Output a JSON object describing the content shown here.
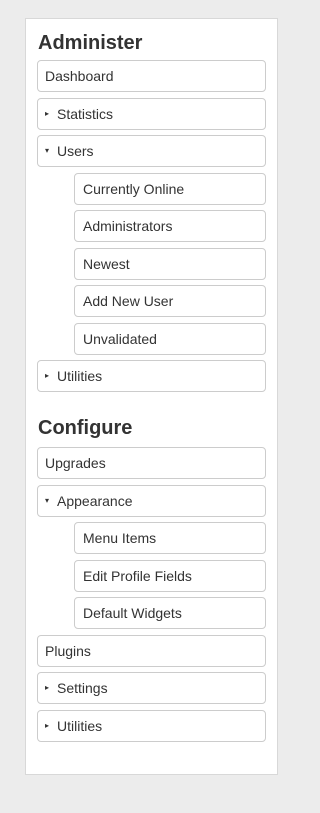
{
  "sections": [
    {
      "title": "Administer",
      "items": [
        {
          "label": "Dashboard",
          "arrow": ""
        },
        {
          "label": "Statistics",
          "arrow": "▸"
        },
        {
          "label": "Users",
          "arrow": "▾"
        },
        {
          "label": "Currently Online"
        },
        {
          "label": "Administrators"
        },
        {
          "label": "Newest"
        },
        {
          "label": "Add New User"
        },
        {
          "label": "Unvalidated"
        },
        {
          "label": "Utilities",
          "arrow": "▸"
        }
      ]
    },
    {
      "title": "Configure",
      "items": [
        {
          "label": "Upgrades",
          "arrow": ""
        },
        {
          "label": "Appearance",
          "arrow": "▾"
        },
        {
          "label": "Menu Items"
        },
        {
          "label": "Edit Profile Fields"
        },
        {
          "label": "Default Widgets"
        },
        {
          "label": "Plugins",
          "arrow": ""
        },
        {
          "label": "Settings",
          "arrow": "▸"
        },
        {
          "label": "Utilities",
          "arrow": "▸"
        }
      ]
    }
  ]
}
